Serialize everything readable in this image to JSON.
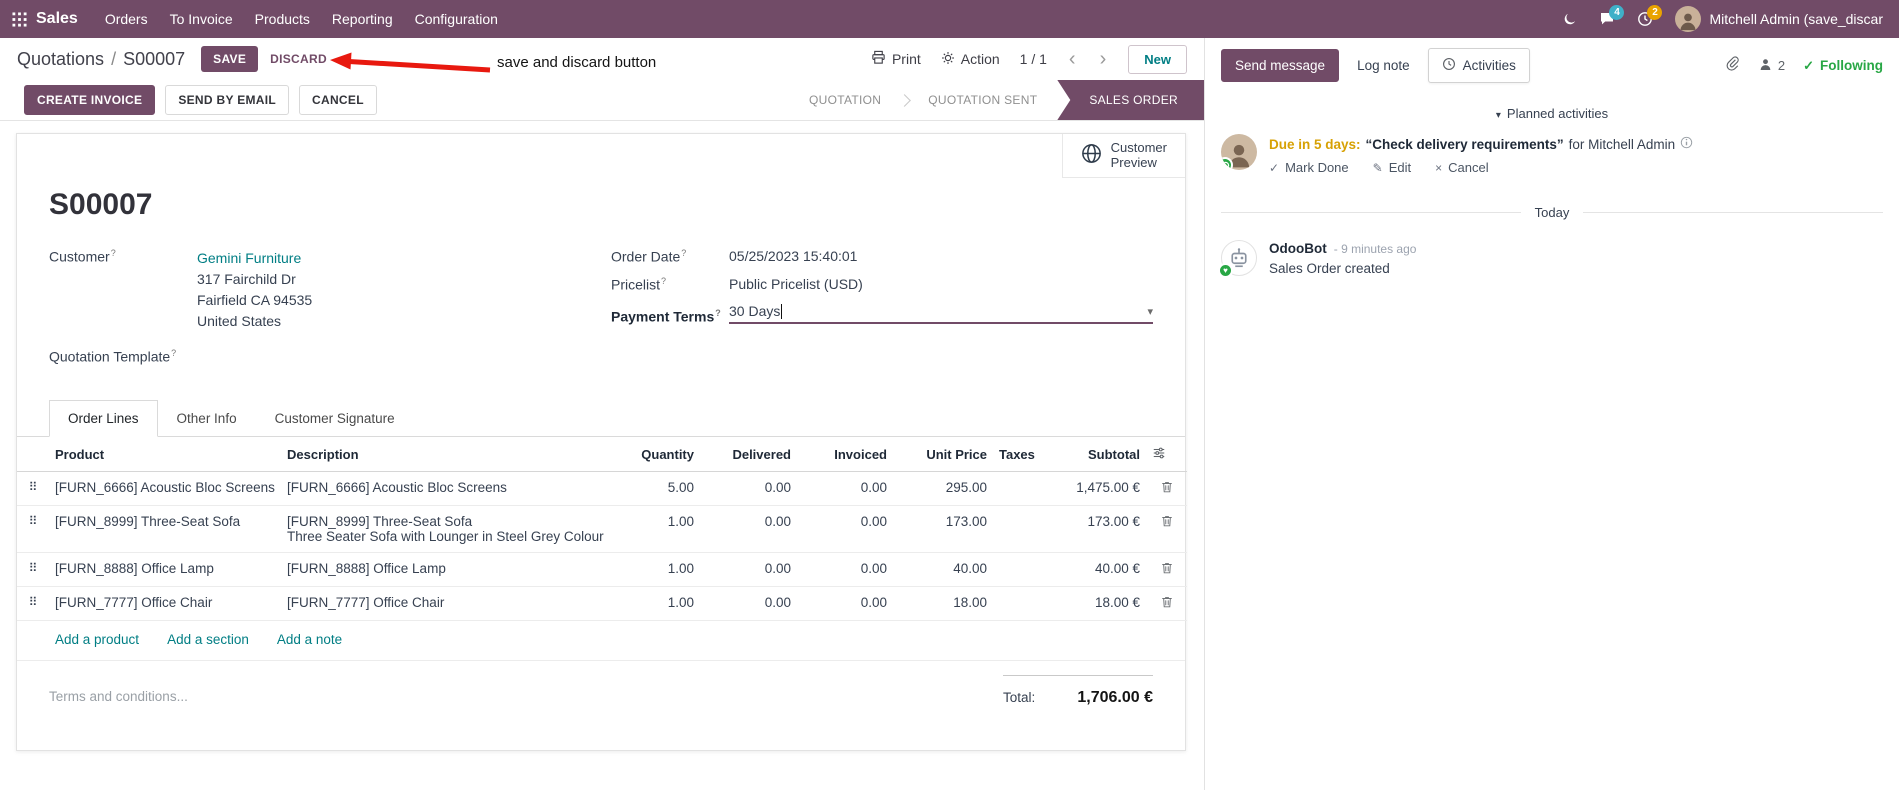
{
  "colors": {
    "brand": "#714B67",
    "link": "#017e84",
    "edited_value": "#2079c0",
    "due_warning": "#d7a104",
    "success_green": "#28a745",
    "annotation_arrow": "#e8190f",
    "active_state_bg": "#714B67",
    "messages_badge_bg": "#3fb0c8",
    "activities_badge_bg": "#eaa300"
  },
  "glyphs": {
    "caret_down": "▾",
    "chevron_left": "‹",
    "chevron_right": "›",
    "check": "✓",
    "pencil": "✎",
    "cross": "×",
    "drag_handle": "⠿",
    "help": "?",
    "breadcrumb_separator": "/"
  },
  "topbar": {
    "app_label": "Sales",
    "menus": [
      "Orders",
      "To Invoice",
      "Products",
      "Reporting",
      "Configuration"
    ],
    "messages_badge": "4",
    "activities_badge": "2",
    "user_name": "Mitchell Admin (save_discar"
  },
  "control_panel": {
    "parent": "Quotations",
    "current": "S00007",
    "save": "SAVE",
    "discard": "DISCARD",
    "print": "Print",
    "action": "Action",
    "pager": "1 / 1",
    "new": "New",
    "annotation": "save and discard button"
  },
  "status_bar": {
    "create_invoice": "CREATE INVOICE",
    "send_by_email": "SEND BY EMAIL",
    "cancel": "CANCEL",
    "states": [
      "QUOTATION",
      "QUOTATION SENT",
      "SALES ORDER"
    ],
    "active_state": "SALES ORDER"
  },
  "sheet": {
    "customer_preview": {
      "line1": "Customer",
      "line2": "Preview"
    },
    "title": "S00007",
    "fields": {
      "customer_label": "Customer",
      "customer_name": "Gemini Furniture",
      "address_line1": "317 Fairchild Dr",
      "address_line2": "Fairfield CA 94535",
      "address_line3": "United States",
      "quotation_template_label": "Quotation Template",
      "order_date_label": "Order Date",
      "order_date_value": "05/25/2023 15:40:01",
      "pricelist_label": "Pricelist",
      "pricelist_value": "Public Pricelist (USD)",
      "payment_terms_label": "Payment Terms",
      "payment_terms_value": "30 Days"
    },
    "tabs": [
      "Order Lines",
      "Other Info",
      "Customer Signature"
    ],
    "order_lines": {
      "headers": {
        "product": "Product",
        "description": "Description",
        "quantity": "Quantity",
        "delivered": "Delivered",
        "invoiced": "Invoiced",
        "unit_price": "Unit Price",
        "taxes": "Taxes",
        "subtotal": "Subtotal"
      },
      "rows": [
        {
          "product": "[FURN_6666] Acoustic Bloc Screens",
          "desc1": "[FURN_6666] Acoustic Bloc Screens",
          "desc2": "",
          "qty": "5.00",
          "delivered": "0.00",
          "invoiced": "0.00",
          "unit_price": "295.00",
          "taxes": "",
          "subtotal": "1,475.00 €"
        },
        {
          "product": "[FURN_8999] Three-Seat Sofa",
          "desc1": "[FURN_8999] Three-Seat Sofa",
          "desc2": "Three Seater Sofa with Lounger in Steel Grey Colour",
          "qty": "1.00",
          "delivered": "0.00",
          "invoiced": "0.00",
          "unit_price": "173.00",
          "taxes": "",
          "subtotal": "173.00 €"
        },
        {
          "product": "[FURN_8888] Office Lamp",
          "desc1": "[FURN_8888] Office Lamp",
          "desc2": "",
          "qty": "1.00",
          "delivered": "0.00",
          "invoiced": "0.00",
          "unit_price": "40.00",
          "taxes": "",
          "subtotal": "40.00 €"
        },
        {
          "product": "[FURN_7777] Office Chair",
          "desc1": "[FURN_7777] Office Chair",
          "desc2": "",
          "qty": "1.00",
          "delivered": "0.00",
          "invoiced": "0.00",
          "unit_price": "18.00",
          "taxes": "",
          "subtotal": "18.00 €"
        }
      ],
      "add_product": "Add a product",
      "add_section": "Add a section",
      "add_note": "Add a note"
    },
    "terms_placeholder": "Terms and conditions...",
    "totals": {
      "label": "Total:",
      "value": "1,706.00 €"
    }
  },
  "chatter": {
    "send_message": "Send message",
    "log_note": "Log note",
    "activities_tab": "Activities",
    "followers_count": "2",
    "following_label": "Following",
    "planned_header": "Planned activities",
    "activity": {
      "due": "Due in 5 days:",
      "summary": "“Check delivery requirements”",
      "assignee": "for Mitchell Admin",
      "mark_done": "Mark Done",
      "edit": "Edit",
      "cancel": "Cancel"
    },
    "date_divider": "Today",
    "message": {
      "author": "OdooBot",
      "time": "- 9 minutes ago",
      "body": "Sales Order created"
    }
  }
}
